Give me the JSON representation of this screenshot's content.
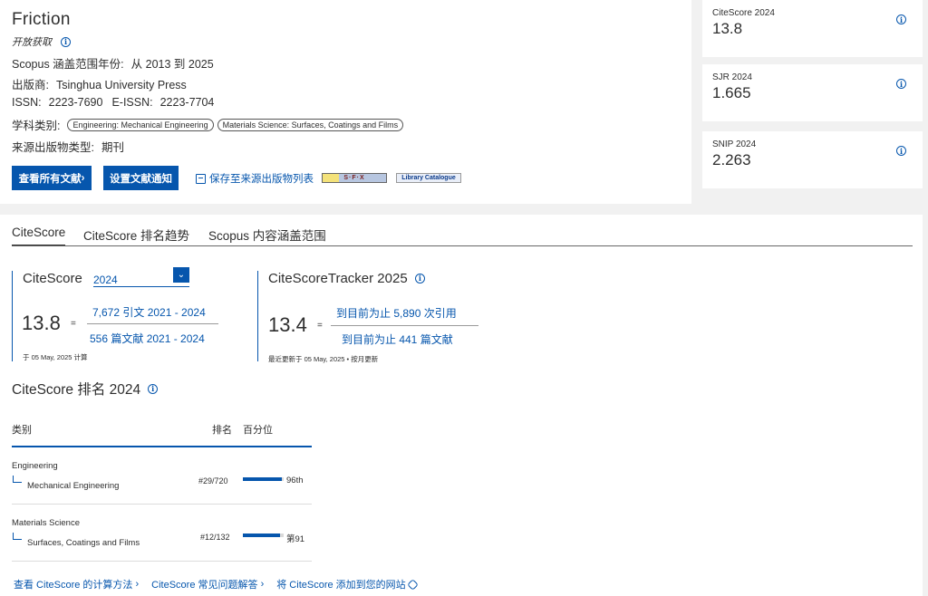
{
  "journal": {
    "title": "Friction",
    "open_access": "开放获取",
    "coverage_label": "Scopus 涵盖范围年份:",
    "coverage_value": "从 2013 到 2025",
    "publisher_label": "出版商:",
    "publisher_value": "Tsinghua University Press",
    "issn_label": "ISSN:",
    "issn_value": "2223-7690",
    "eissn_label": "E-ISSN:",
    "eissn_value": "2223-7704",
    "subject_label": "学科类别:",
    "subjects": [
      "Engineering: Mechanical Engineering",
      "Materials Science: Surfaces, Coatings and Films"
    ],
    "source_type_label": "来源出版物类型:",
    "source_type_value": "期刊"
  },
  "actions": {
    "view_all": "查看所有文献",
    "set_alert": "设置文献通知",
    "save_list": "保存至来源出版物列表",
    "sfx": "S·F·X",
    "library_catalogue": "Library Catalogue"
  },
  "metrics": [
    {
      "label": "CiteScore 2024",
      "value": "13.8"
    },
    {
      "label": "SJR 2024",
      "value": "1.665"
    },
    {
      "label": "SNIP 2024",
      "value": "2.263"
    }
  ],
  "tabs": [
    "CiteScore",
    "CiteScore 排名趋势",
    "Scopus 内容涵盖范围"
  ],
  "citescore": {
    "title": "CiteScore",
    "year": "2024",
    "value": "13.8",
    "eq": "=",
    "numerator": "7,672 引文 2021 - 2024",
    "denominator": "556 篇文献 2021 - 2024",
    "calc_note": "于 05 May, 2025 计算"
  },
  "tracker": {
    "title": "CiteScoreTracker 2025",
    "value": "13.4",
    "eq": "=",
    "numerator": "到目前为止 5,890 次引用",
    "denominator": "到目前为止 441 篇文献",
    "update_note": "最近更新于 05 May, 2025 • 按月更新"
  },
  "ranking": {
    "title": "CiteScore 排名 2024",
    "col_category": "类别",
    "col_rank": "排名",
    "col_percentile": "百分位",
    "rows": [
      {
        "category": "Engineering",
        "subcategory": "Mechanical Engineering",
        "rank": "#29/720",
        "percentile": 96,
        "percentile_label": "96th"
      },
      {
        "category": "Materials Science",
        "subcategory": "Surfaces, Coatings and Films",
        "rank": "#12/132",
        "percentile": 91,
        "percentile_label": "第91"
      }
    ]
  },
  "footer": {
    "link1": "查看 CiteScore 的计算方法",
    "link2": "CiteScore 常见问题解答",
    "link3": "将 CiteScore 添加到您的网站"
  }
}
